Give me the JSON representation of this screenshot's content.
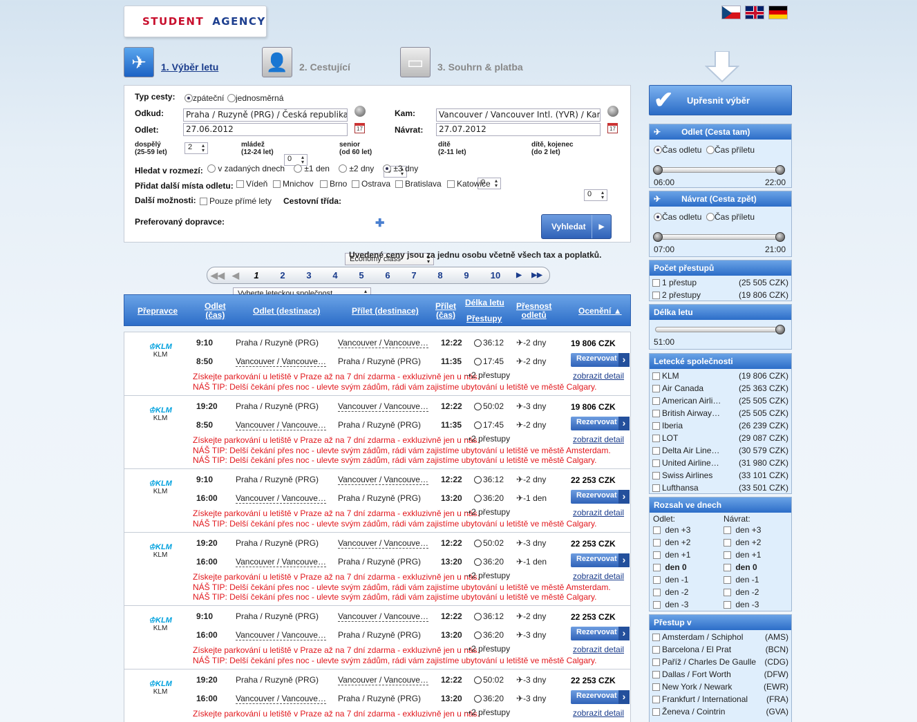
{
  "brand": {
    "left": "STUDENT",
    "right": "AGENCY"
  },
  "steps": [
    {
      "label": "1. Výběr letu"
    },
    {
      "label": "2. Cestující"
    },
    {
      "label": "3. Souhrn & platba"
    }
  ],
  "form": {
    "trip_type_label": "Typ cesty:",
    "round": "zpáteční",
    "oneway": "jednosměrná",
    "from_label": "Odkud:",
    "from_value": "Praha / Ruzyně (PRG) / Česká republika",
    "to_label": "Kam:",
    "to_value": "Vancouver / Vancouver Intl. (YVR) / Kanada",
    "dep_label": "Odlet:",
    "dep_value": "27.06.2012",
    "ret_label": "Návrat:",
    "ret_value": "27.07.2012",
    "pax": [
      {
        "l1": "dospělý",
        "l2": "(25-59 let)",
        "v": "2"
      },
      {
        "l1": "mládež",
        "l2": "(12-24 let)",
        "v": "0"
      },
      {
        "l1": "senior",
        "l2": "(od 60 let)",
        "v": "0"
      },
      {
        "l1": "dítě",
        "l2": "(2-11 let)",
        "v": "0"
      },
      {
        "l1": "dítě, kojenec",
        "l2": "(do 2 let)",
        "v": "0"
      }
    ],
    "range_label": "Hledat v rozmezí:",
    "r0": "v zadaných dnech",
    "r1": "±1 den",
    "r2": "±2 dny",
    "r3": "±3 dny",
    "extra_label": "Přidat další místa odletu:",
    "extra": [
      "Vídeň",
      "Mnichov",
      "Brno",
      "Ostrava",
      "Bratislava",
      "Katowice"
    ],
    "more_label": "Další možnosti:",
    "direct": "Pouze přímé lety",
    "class_label": "Cestovní třída:",
    "class_value": "Economy class",
    "carrier_label": "Preferovaný dopravce:",
    "carrier_value": "Vyberte leteckou společnost",
    "search": "Vyhledat"
  },
  "note": "Uvedené ceny jsou za jednu osobu včetně všech tax a poplatků.",
  "pager": [
    "1",
    "2",
    "3",
    "4",
    "5",
    "6",
    "7",
    "8",
    "9",
    "10"
  ],
  "table_head": {
    "carrier": "Přepravce",
    "dep1": "Odlet",
    "dep2": "(čas)",
    "depdest": "Odlet (destinace)",
    "arrdest": "Přílet (destinace)",
    "arr1": "Přílet",
    "arr2": "(čas)",
    "len": "Délka letu",
    "stops": "Přestupy",
    "acc1": "Přesnost",
    "acc2": "odletů",
    "rating": "Ocenění"
  },
  "rows": [
    {
      "airline": "KLM",
      "o_dep": "9:10",
      "o_from": "Praha / Ruzyně (PRG)",
      "o_to": "Vancouver / Vancouve…",
      "o_arr": "12:22",
      "o_dur": "36:12",
      "o_acc": "-2 dny",
      "r_dep": "8:50",
      "r_from": "Vancouver / Vancouve…",
      "r_to": "Praha / Ruzyně (PRG)",
      "r_arr": "11:35",
      "r_dur": "17:45",
      "r_acc": "-2 dny",
      "price": "19 806 CZK",
      "book": "Rezervovat",
      "promo": "Získejte parkování u letiště v Praze až na 7 dní zdarma - exkluzivně jen u nás.",
      "stops": "2 přestupy",
      "detail": "zobrazit detail",
      "tips": [
        "NÁŠ TIP: Delší čekání přes noc - ulevte svým zádům, rádi vám zajistíme ubytování u letiště ve městě Calgary."
      ]
    },
    {
      "airline": "KLM",
      "o_dep": "19:20",
      "o_from": "Praha / Ruzyně (PRG)",
      "o_to": "Vancouver / Vancouve…",
      "o_arr": "12:22",
      "o_dur": "50:02",
      "o_acc": "-3 dny",
      "r_dep": "8:50",
      "r_from": "Vancouver / Vancouve…",
      "r_to": "Praha / Ruzyně (PRG)",
      "r_arr": "11:35",
      "r_dur": "17:45",
      "r_acc": "-2 dny",
      "price": "19 806 CZK",
      "book": "Rezervovat",
      "promo": "Získejte parkování u letiště v Praze až na 7 dní zdarma - exkluzivně jen u nás.",
      "stops": "2 přestupy",
      "detail": "zobrazit detail",
      "tips": [
        "NÁŠ TIP: Delší čekání přes noc - ulevte svým zádům, rádi vám zajistíme ubytování u letiště ve městě Amsterdam.",
        "NÁŠ TIP: Delší čekání přes noc - ulevte svým zádům, rádi vám zajistíme ubytování u letiště ve městě Calgary."
      ]
    },
    {
      "airline": "KLM",
      "o_dep": "9:10",
      "o_from": "Praha / Ruzyně (PRG)",
      "o_to": "Vancouver / Vancouve…",
      "o_arr": "12:22",
      "o_dur": "36:12",
      "o_acc": "-2 dny",
      "r_dep": "16:00",
      "r_from": "Vancouver / Vancouve…",
      "r_to": "Praha / Ruzyně (PRG)",
      "r_arr": "13:20",
      "r_dur": "36:20",
      "r_acc": "-1 den",
      "price": "22 253 CZK",
      "book": "Rezervovat",
      "promo": "Získejte parkování u letiště v Praze až na 7 dní zdarma - exkluzivně jen u nás.",
      "stops": "2 přestupy",
      "detail": "zobrazit detail",
      "tips": [
        "NÁŠ TIP: Delší čekání přes noc - ulevte svým zádům, rádi vám zajistíme ubytování u letiště ve městě Calgary."
      ]
    },
    {
      "airline": "KLM",
      "o_dep": "19:20",
      "o_from": "Praha / Ruzyně (PRG)",
      "o_to": "Vancouver / Vancouve…",
      "o_arr": "12:22",
      "o_dur": "50:02",
      "o_acc": "-3 dny",
      "r_dep": "16:00",
      "r_from": "Vancouver / Vancouve…",
      "r_to": "Praha / Ruzyně (PRG)",
      "r_arr": "13:20",
      "r_dur": "36:20",
      "r_acc": "-1 den",
      "price": "22 253 CZK",
      "book": "Rezervovat",
      "promo": "Získejte parkování u letiště v Praze až na 7 dní zdarma - exkluzivně jen u nás.",
      "stops": "2 přestupy",
      "detail": "zobrazit detail",
      "tips": [
        "NÁŠ TIP: Delší čekání přes noc - ulevte svým zádům, rádi vám zajistíme ubytování u letiště ve městě Amsterdam.",
        "NÁŠ TIP: Delší čekání přes noc - ulevte svým zádům, rádi vám zajistíme ubytování u letiště ve městě Calgary."
      ]
    },
    {
      "airline": "KLM",
      "o_dep": "9:10",
      "o_from": "Praha / Ruzyně (PRG)",
      "o_to": "Vancouver / Vancouve…",
      "o_arr": "12:22",
      "o_dur": "36:12",
      "o_acc": "-2 dny",
      "r_dep": "16:00",
      "r_from": "Vancouver / Vancouve…",
      "r_to": "Praha / Ruzyně (PRG)",
      "r_arr": "13:20",
      "r_dur": "36:20",
      "r_acc": "-3 dny",
      "price": "22 253 CZK",
      "book": "Rezervovat",
      "promo": "Získejte parkování u letiště v Praze až na 7 dní zdarma - exkluzivně jen u nás.",
      "stops": "2 přestupy",
      "detail": "zobrazit detail",
      "tips": [
        "NÁŠ TIP: Delší čekání přes noc - ulevte svým zádům, rádi vám zajistíme ubytování u letiště ve městě Calgary."
      ]
    },
    {
      "airline": "KLM",
      "o_dep": "19:20",
      "o_from": "Praha / Ruzyně (PRG)",
      "o_to": "Vancouver / Vancouve…",
      "o_arr": "12:22",
      "o_dur": "50:02",
      "o_acc": "-3 dny",
      "r_dep": "16:00",
      "r_from": "Vancouver / Vancouve…",
      "r_to": "Praha / Ruzyně (PRG)",
      "r_arr": "13:20",
      "r_dur": "36:20",
      "r_acc": "-3 dny",
      "price": "22 253 CZK",
      "book": "Rezervovat",
      "promo": "Získejte parkování u letiště v Praze až na 7 dní zdarma - exkluzivně jen u nás.",
      "stops": "2 přestupy",
      "detail": "zobrazit detail",
      "tips": []
    }
  ],
  "sidebar": {
    "refine": "Upřesnit výběr",
    "out_title": "Odlet (Cesta tam)",
    "ret_title": "Návrat (Cesta zpět)",
    "dep_time": "Čas odletu",
    "arr_time": "Čas příletu",
    "out_min": "06:00",
    "out_max": "22:00",
    "ret_min": "07:00",
    "ret_max": "21:00",
    "stops_title": "Počet přestupů",
    "stops": [
      {
        "name": "1 přestup",
        "price": "(25 505 CZK)"
      },
      {
        "name": "2 přestupy",
        "price": "(19 806 CZK)"
      }
    ],
    "len_title": "Délka letu",
    "len_val": "51:00",
    "airlines_title": "Letecké společnosti",
    "airlines": [
      {
        "name": "KLM",
        "price": "(19 806 CZK)"
      },
      {
        "name": "Air Canada",
        "price": "(25 363 CZK)"
      },
      {
        "name": "American Airli…",
        "price": "(25 505 CZK)"
      },
      {
        "name": "British Airway…",
        "price": "(25 505 CZK)"
      },
      {
        "name": "Iberia",
        "price": "(26 239 CZK)"
      },
      {
        "name": "LOT",
        "price": "(29 087 CZK)"
      },
      {
        "name": "Delta Air Line…",
        "price": "(30 579 CZK)"
      },
      {
        "name": "United Airline…",
        "price": "(31 980 CZK)"
      },
      {
        "name": "Swiss Airlines",
        "price": "(33 101 CZK)"
      },
      {
        "name": "Lufthansa",
        "price": "(33 501 CZK)"
      }
    ],
    "days_title": "Rozsah ve dnech",
    "days_dep": "Odlet:",
    "days_ret": "Návrat:",
    "days": [
      "den +3",
      "den +2",
      "den +1",
      "den 0",
      "den -1",
      "den -2",
      "den -3"
    ],
    "via_title": "Přestup v",
    "via": [
      {
        "name": "Amsterdam / Schiphol",
        "code": "(AMS)"
      },
      {
        "name": "Barcelona / El Prat",
        "code": "(BCN)"
      },
      {
        "name": "Paříž / Charles De Gaulle",
        "code": "(CDG)"
      },
      {
        "name": "Dallas / Fort Worth",
        "code": "(DFW)"
      },
      {
        "name": "New York / Newark",
        "code": "(EWR)"
      },
      {
        "name": "Frankfurt / International",
        "code": "(FRA)"
      },
      {
        "name": "Ženeva / Cointrin",
        "code": "(GVA)"
      }
    ]
  },
  "colors": {
    "accent": "#2c6dc8",
    "promo": "#e1161b",
    "link": "#1a3c8c"
  }
}
